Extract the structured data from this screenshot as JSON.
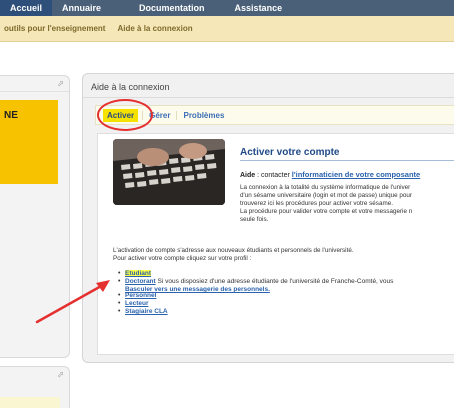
{
  "topnav": {
    "tabs": [
      {
        "label": "Accueil"
      },
      {
        "label": "Annuaire"
      },
      {
        "label": "Documentation"
      },
      {
        "label": "Assistance"
      }
    ]
  },
  "subnav": {
    "links": [
      {
        "label": "outils pour l'enseignement"
      },
      {
        "label": "Aide à la connexion"
      }
    ]
  },
  "left_panel": {
    "banner_text": "NE"
  },
  "main_panel": {
    "title": "Aide à la connexion",
    "tabs": [
      {
        "label": "Activer",
        "active": true
      },
      {
        "label": "Gérer",
        "active": false
      },
      {
        "label": "Problèmes",
        "active": false
      }
    ],
    "heading": "Activer votre compte",
    "aide_label": "Aide",
    "aide_text": " : contacter ",
    "aide_link": "l'informaticien de votre composante",
    "paragraph_lines": [
      "La connexion à la totalité du système informatique de l'univer",
      "d'un sésame universitaire (login et mot de passe) unique pour",
      "trouverez ici les procédures pour activer votre sésame.",
      "La procédure pour valider votre compte et votre messagerie n",
      "seule fois."
    ],
    "intro_lines": [
      "L'activation de compte s'adresse aux nouveaux étudiants et personnels de l'université.",
      "Pour activer votre compte cliquez sur votre profil :"
    ],
    "profiles": {
      "etudiant": "Etudiant",
      "doctorant": "Doctorant",
      "doctorant_note": "  Si vous disposiez d'une adresse étudiante de l'université de Franche-Comté, vous",
      "doctorant_sub": "Basculer vers une messagerie des personnels.",
      "personnel": "Personnel",
      "lecteur": "Lecteur",
      "stagiaire": "Stagiaire CLA"
    }
  },
  "colors": {
    "nav_bg": "#4a6078",
    "subnav_bg": "#f6e7b9",
    "accent_yellow": "#f6e200",
    "link_blue": "#2a62ad",
    "annotation_red": "#e53030"
  }
}
